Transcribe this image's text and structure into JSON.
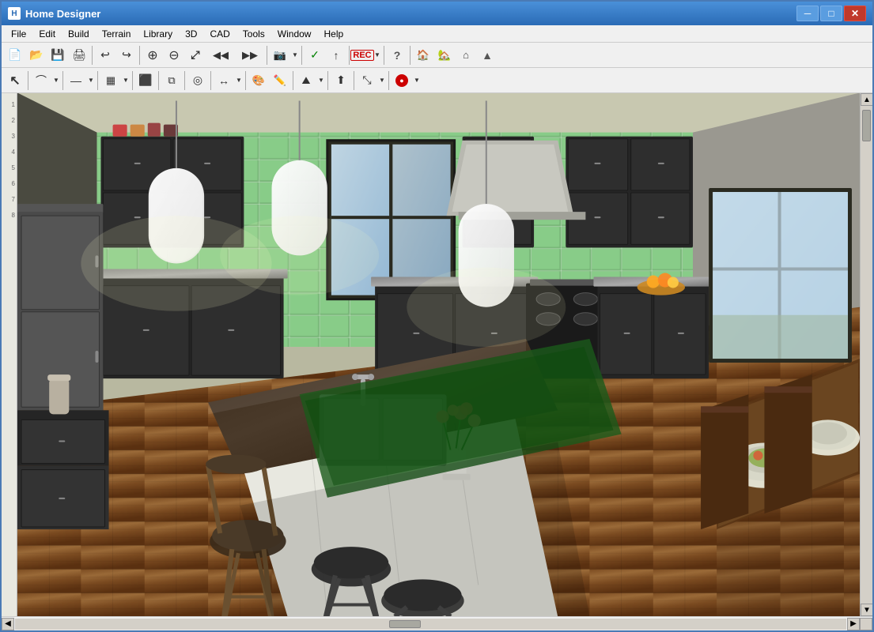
{
  "window": {
    "title": "Home Designer",
    "icon": "HD"
  },
  "title_controls": {
    "minimize": "─",
    "maximize": "□",
    "close": "✕"
  },
  "menu": {
    "items": [
      "File",
      "Edit",
      "Build",
      "Terrain",
      "Library",
      "3D",
      "CAD",
      "Tools",
      "Window",
      "Help"
    ]
  },
  "toolbar1": {
    "buttons": [
      {
        "name": "new",
        "label": "📄",
        "tooltip": "New"
      },
      {
        "name": "open",
        "label": "📂",
        "tooltip": "Open"
      },
      {
        "name": "save",
        "label": "💾",
        "tooltip": "Save"
      },
      {
        "name": "print",
        "label": "🖨",
        "tooltip": "Print"
      },
      {
        "name": "undo",
        "label": "↩",
        "tooltip": "Undo"
      },
      {
        "name": "redo",
        "label": "↪",
        "tooltip": "Redo"
      },
      {
        "name": "zoom-in",
        "label": "⊕",
        "tooltip": "Zoom In"
      },
      {
        "name": "zoom-out",
        "label": "⊖",
        "tooltip": "Zoom Out"
      },
      {
        "name": "fit",
        "label": "⤢",
        "tooltip": "Fit"
      },
      {
        "name": "prev-view",
        "label": "◀",
        "tooltip": "Previous View"
      },
      {
        "name": "next-view",
        "label": "▶",
        "tooltip": "Next View"
      },
      {
        "name": "camera",
        "label": "📷",
        "tooltip": "Camera"
      },
      {
        "name": "check",
        "label": "✓",
        "tooltip": "Check"
      },
      {
        "name": "arrow-up",
        "label": "↑",
        "tooltip": "Arrow"
      },
      {
        "name": "help",
        "label": "?",
        "tooltip": "Help"
      },
      {
        "name": "house1",
        "label": "🏠",
        "tooltip": "House 1"
      },
      {
        "name": "house2",
        "label": "🏡",
        "tooltip": "House 2"
      },
      {
        "name": "house3",
        "label": "⌂",
        "tooltip": "House 3"
      },
      {
        "name": "house4",
        "label": "▲",
        "tooltip": "House 4"
      }
    ]
  },
  "toolbar2": {
    "buttons": [
      {
        "name": "select",
        "label": "↖",
        "tooltip": "Select"
      },
      {
        "name": "polyline",
        "label": "⌒",
        "tooltip": "Polyline"
      },
      {
        "name": "line",
        "label": "—",
        "tooltip": "Line"
      },
      {
        "name": "wall",
        "label": "▦",
        "tooltip": "Wall"
      },
      {
        "name": "room",
        "label": "⬜",
        "tooltip": "Room"
      },
      {
        "name": "stairs",
        "label": "⬛",
        "tooltip": "Stairs"
      },
      {
        "name": "copy",
        "label": "⧉",
        "tooltip": "Copy"
      },
      {
        "name": "symbol",
        "label": "◎",
        "tooltip": "Symbol"
      },
      {
        "name": "dimension",
        "label": "↔",
        "tooltip": "Dimension"
      },
      {
        "name": "color",
        "label": "🎨",
        "tooltip": "Color"
      },
      {
        "name": "material",
        "label": "◼",
        "tooltip": "Material"
      },
      {
        "name": "terrain",
        "label": "⛰",
        "tooltip": "Terrain"
      },
      {
        "name": "arrow",
        "label": "⬆",
        "tooltip": "Arrow"
      },
      {
        "name": "transform",
        "label": "⤢",
        "tooltip": "Transform"
      },
      {
        "name": "record",
        "label": "⏺",
        "tooltip": "Record"
      }
    ]
  },
  "scrollbar": {
    "up_arrow": "▲",
    "down_arrow": "▼",
    "left_arrow": "◀",
    "right_arrow": "▶"
  },
  "scene": {
    "description": "3D kitchen interior render"
  }
}
